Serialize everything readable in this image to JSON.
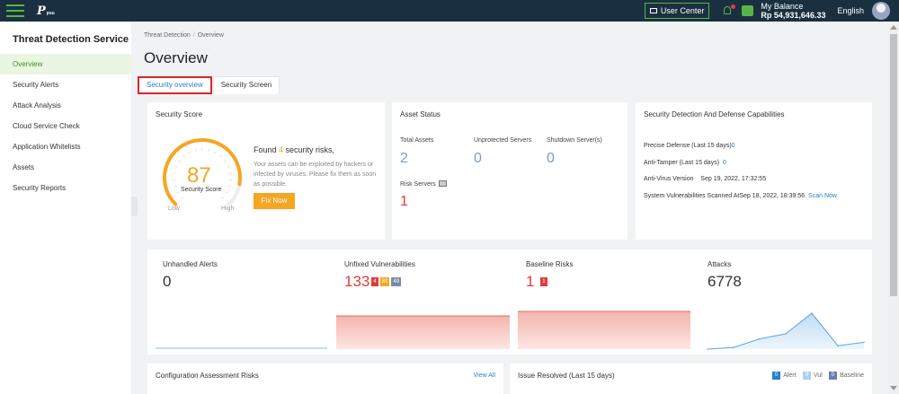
{
  "topbar": {
    "logo_text": "P",
    "logo_sub": "psu",
    "user_center": "User Center",
    "balance_label": "My Balance",
    "balance_value": "Rp 54,931,646.33",
    "language": "English",
    "accent": "#55b647"
  },
  "sidebar": {
    "title": "Threat Detection Service",
    "items": [
      {
        "label": "Overview"
      },
      {
        "label": "Security Alerts"
      },
      {
        "label": "Attack Analysis"
      },
      {
        "label": "Cloud Service Check"
      },
      {
        "label": "Application Whitelists"
      },
      {
        "label": "Assets"
      },
      {
        "label": "Security Reports"
      }
    ]
  },
  "breadcrumb": {
    "parent": "Threat Detection",
    "current": "Overview"
  },
  "page_title": "Overview",
  "tabs": [
    {
      "label": "Security overview"
    },
    {
      "label": "Security Screen"
    }
  ],
  "security_score": {
    "title": "Security Score",
    "score": "87",
    "score_label": "Security Score",
    "low": "Low",
    "high": "High",
    "found_prefix": "Found ",
    "found_count": "4",
    "found_suffix": " security risks,",
    "description": "Your assets can be exploited by hackers or infected by viruses. Please fix them as soon as possible.",
    "fix_button": "Fix Now",
    "score_fraction": 0.87
  },
  "asset_status": {
    "title": "Asset Status",
    "total_assets_label": "Total Assets",
    "total_assets": "2",
    "unprotected_label": "Unprotected Servers",
    "unprotected": "0",
    "shutdown_label": "Shutdown Server(s)",
    "shutdown": "0",
    "risk_servers_label": "Risk Servers",
    "risk_servers": "1"
  },
  "capabilities": {
    "title": "Security Detection And Defense Capabilities",
    "precise_defense_label": "Precise Defense (Last 15 days)",
    "precise_defense": "0",
    "anti_tamper_label": "Anti-Tamper  (Last 15 days)",
    "anti_tamper": "0",
    "antivirus_label": "Anti-Virus Version",
    "antivirus": "Sep 19, 2022, 17:32:55",
    "vuln_scan_label": "System Vulnerabilities Scanned At",
    "vuln_scan": "Sep 18, 2022, 18:39:56",
    "scan_now": "Scan Now"
  },
  "stats": {
    "unhandled_alerts_label": "Unhandled Alerts",
    "unhandled_alerts": "0",
    "unfixed_vulns_label": "Unfixed Vulnerabilities",
    "unfixed_vulns": "133",
    "unfixed_badges": [
      "4",
      "80",
      "49"
    ],
    "baseline_risks_label": "Baseline Risks",
    "baseline_risks": "1",
    "baseline_badge": "1",
    "attacks_label": "Attacks",
    "attacks": "6778"
  },
  "chart_data": {
    "type": "area",
    "values": [
      0,
      2,
      12,
      18,
      42,
      4,
      8
    ]
  },
  "bottom": {
    "config_title": "Configuration Assessment Risks",
    "view_all": "View All",
    "issues_title": "Issue Resolved (Last 15 days)",
    "legend": [
      {
        "count": "0",
        "label": "Alert",
        "color": "#2a7fcb"
      },
      {
        "count": "0",
        "label": "Vul",
        "color": "#aad2f0"
      },
      {
        "count": "0",
        "label": "Baseline",
        "color": "#6b7fb0"
      }
    ]
  }
}
